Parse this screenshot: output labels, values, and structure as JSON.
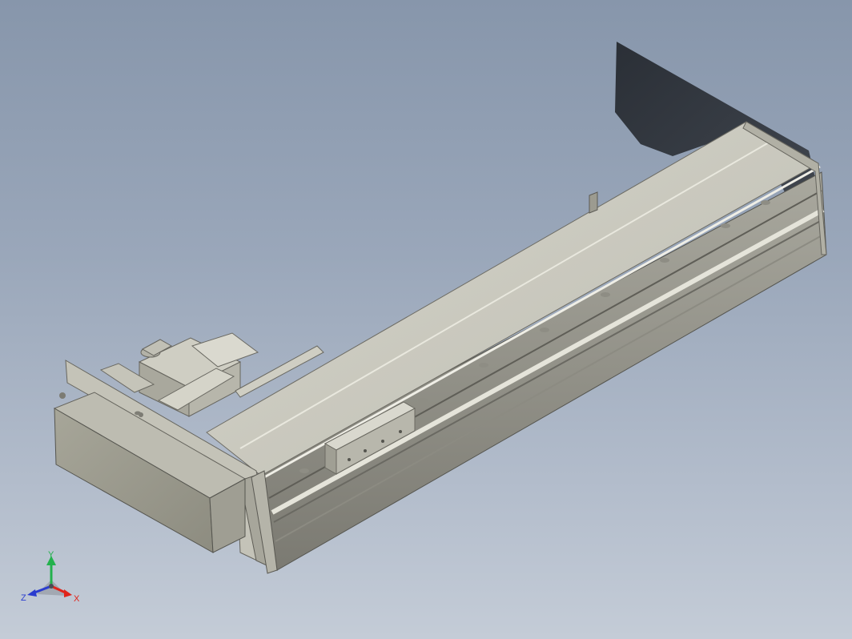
{
  "viewport": {
    "background_top": "#8796ab",
    "background_bottom": "#c4ccd7"
  },
  "model": {
    "part_color": "#c9c8bd",
    "shadow_color": "#2f333a"
  },
  "triad": {
    "x_label": "X",
    "y_label": "Y",
    "z_label": "Z",
    "x_color": "#e0241b",
    "y_color": "#23b14d",
    "z_color": "#2a3ccf"
  }
}
